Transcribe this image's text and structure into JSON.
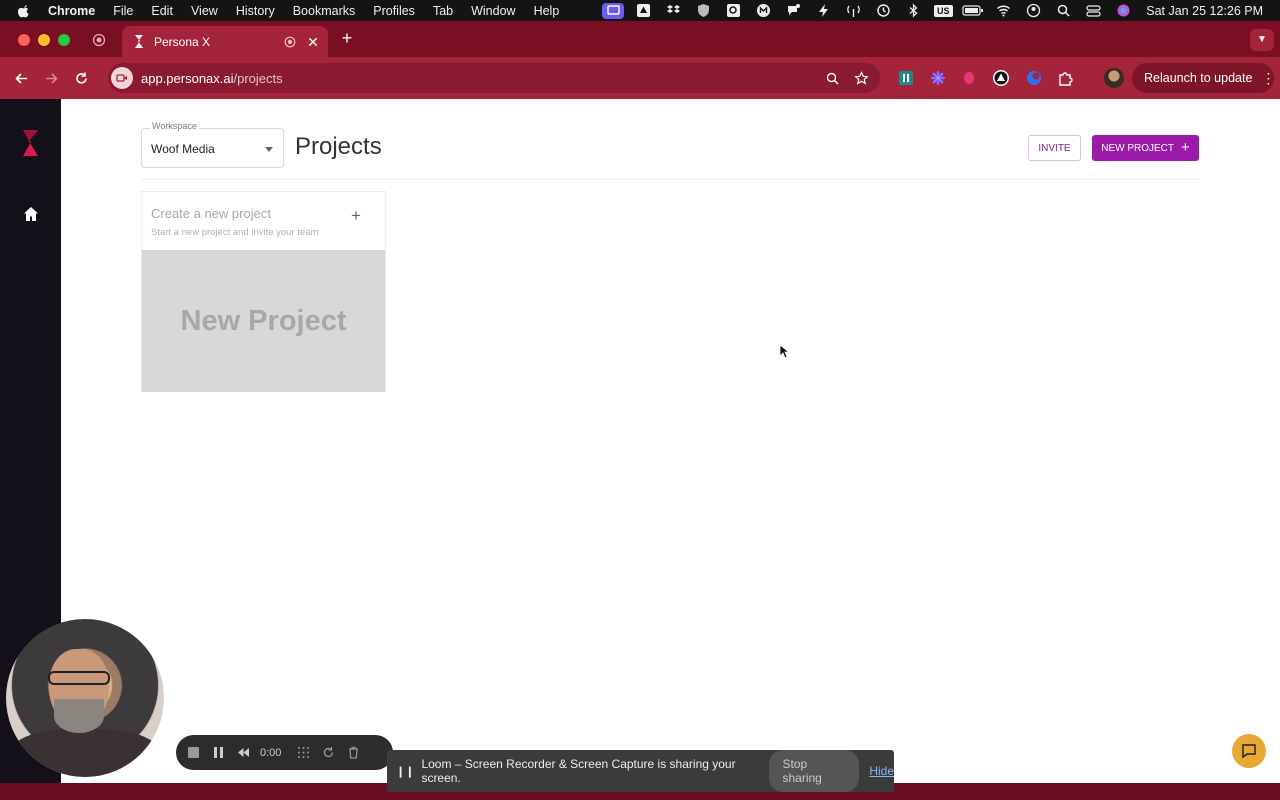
{
  "menubar": {
    "items": [
      "Chrome",
      "File",
      "Edit",
      "View",
      "History",
      "Bookmarks",
      "Profiles",
      "Tab",
      "Window",
      "Help"
    ],
    "keyboard_badge": "US",
    "clock": "Sat Jan 25  12:26 PM"
  },
  "browser": {
    "tab_title": "Persona X",
    "url_host": "app.personax.ai",
    "url_path": "/projects",
    "relaunch_label": "Relaunch to update"
  },
  "app": {
    "workspace_label": "Workspace",
    "workspace_value": "Woof Media",
    "page_title": "Projects",
    "invite_label": "INVITE",
    "new_project_label": "NEW PROJECT",
    "card": {
      "title": "Create a new project",
      "subtitle": "Start a new project and invite your team",
      "thumbnail_text": "New Project"
    }
  },
  "loom": {
    "timer": "0:00",
    "share_message": "Loom – Screen Recorder & Screen Capture is sharing your screen.",
    "stop_label": "Stop sharing",
    "hide_label": "Hide"
  },
  "colors": {
    "brand_accent": "#9b1aa8",
    "chrome_theme": "#a3243b",
    "app_sidebar": "#14101a"
  }
}
